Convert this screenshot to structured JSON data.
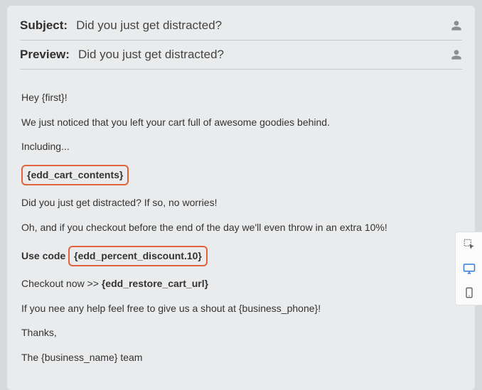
{
  "fields": {
    "subject_label": "Subject:",
    "subject_value": "Did you just get distracted?",
    "preview_label": "Preview:",
    "preview_value": "Did you just get distracted?"
  },
  "body": {
    "line1": "Hey {first}!",
    "line2": "We just noticed that you left your cart full of awesome goodies behind.",
    "line3": "Including...",
    "line4_token": "{edd_cart_contents}",
    "line5": "Did you just get distracted? If so, no worries!",
    "line6": "Oh, and if you checkout before the end of the day we'll even throw in an extra 10%!",
    "line7_prefix": "Use code ",
    "line7_token": "{edd_percent_discount.10}",
    "line8_prefix": "Checkout now >> ",
    "line8_token": "{edd_restore_cart_url}",
    "line9": "If you nee any help feel free to give us a shout at {business_phone}!",
    "line10": "Thanks,",
    "line11": "The {business_name} team"
  },
  "toolbar": {
    "picker": "element-picker",
    "desktop": "desktop-view",
    "mobile": "mobile-view"
  }
}
